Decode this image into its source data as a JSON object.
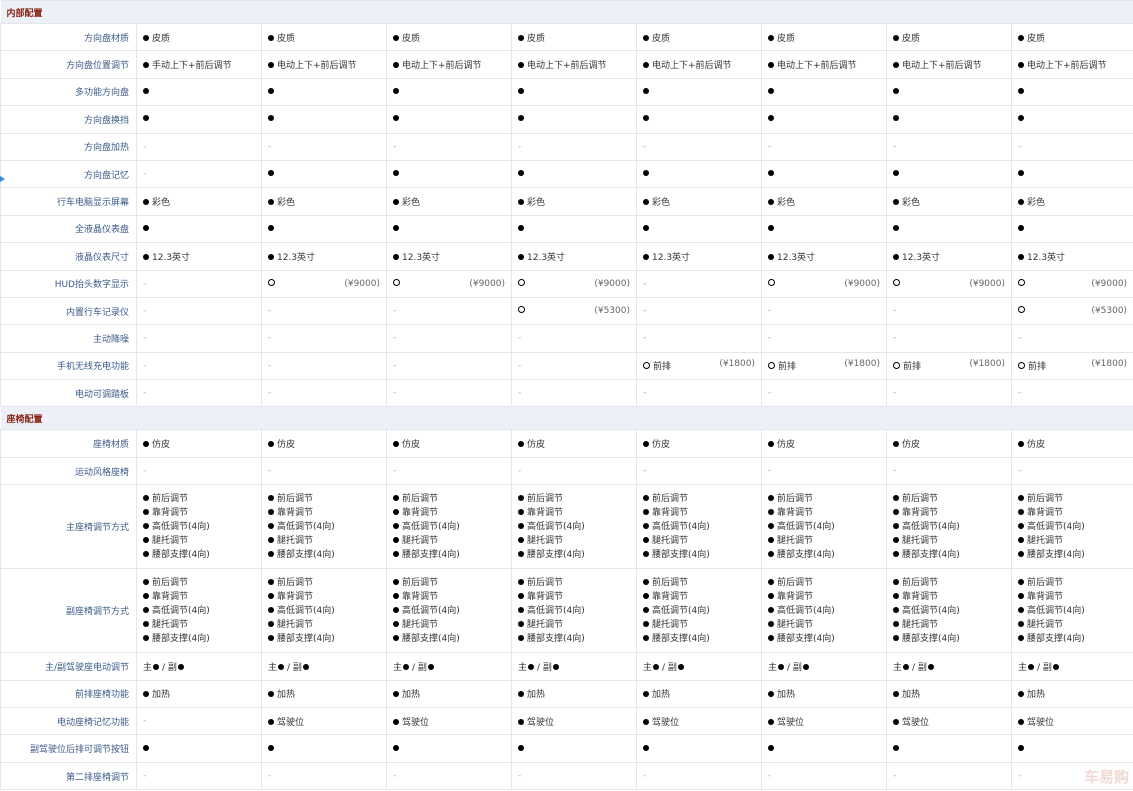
{
  "watermark": "车易购",
  "columns": 8,
  "sections": [
    {
      "title": "内部配置",
      "rows": [
        {
          "label": "方向盘材质",
          "cells": [
            {
              "dot": "filled",
              "text": "皮质"
            },
            {
              "dot": "filled",
              "text": "皮质"
            },
            {
              "dot": "filled",
              "text": "皮质"
            },
            {
              "dot": "filled",
              "text": "皮质"
            },
            {
              "dot": "filled",
              "text": "皮质"
            },
            {
              "dot": "filled",
              "text": "皮质"
            },
            {
              "dot": "filled",
              "text": "皮质"
            },
            {
              "dot": "filled",
              "text": "皮质"
            }
          ]
        },
        {
          "label": "方向盘位置调节",
          "cells": [
            {
              "dot": "filled",
              "text": "手动上下+前后调节"
            },
            {
              "dot": "filled",
              "text": "电动上下+前后调节"
            },
            {
              "dot": "filled",
              "text": "电动上下+前后调节"
            },
            {
              "dot": "filled",
              "text": "电动上下+前后调节"
            },
            {
              "dot": "filled",
              "text": "电动上下+前后调节"
            },
            {
              "dot": "filled",
              "text": "电动上下+前后调节"
            },
            {
              "dot": "filled",
              "text": "电动上下+前后调节"
            },
            {
              "dot": "filled",
              "text": "电动上下+前后调节"
            }
          ]
        },
        {
          "label": "多功能方向盘",
          "cells": [
            {
              "dot": "filled"
            },
            {
              "dot": "filled"
            },
            {
              "dot": "filled"
            },
            {
              "dot": "filled"
            },
            {
              "dot": "filled"
            },
            {
              "dot": "filled"
            },
            {
              "dot": "filled"
            },
            {
              "dot": "filled"
            }
          ]
        },
        {
          "label": "方向盘换挡",
          "cells": [
            {
              "dot": "filled"
            },
            {
              "dot": "filled"
            },
            {
              "dot": "filled"
            },
            {
              "dot": "filled"
            },
            {
              "dot": "filled"
            },
            {
              "dot": "filled"
            },
            {
              "dot": "filled"
            },
            {
              "dot": "filled"
            }
          ]
        },
        {
          "label": "方向盘加热",
          "cells": [
            {
              "text": "-"
            },
            {
              "text": "-"
            },
            {
              "text": "-"
            },
            {
              "text": "-"
            },
            {
              "text": "-"
            },
            {
              "text": "-"
            },
            {
              "text": "-"
            },
            {
              "text": "-"
            }
          ]
        },
        {
          "label": "方向盘记忆",
          "cells": [
            {
              "text": "-"
            },
            {
              "dot": "filled"
            },
            {
              "dot": "filled"
            },
            {
              "dot": "filled"
            },
            {
              "dot": "filled"
            },
            {
              "dot": "filled"
            },
            {
              "dot": "filled"
            },
            {
              "dot": "filled"
            }
          ]
        },
        {
          "label": "行车电脑显示屏幕",
          "cells": [
            {
              "dot": "filled",
              "text": "彩色"
            },
            {
              "dot": "filled",
              "text": "彩色"
            },
            {
              "dot": "filled",
              "text": "彩色"
            },
            {
              "dot": "filled",
              "text": "彩色"
            },
            {
              "dot": "filled",
              "text": "彩色"
            },
            {
              "dot": "filled",
              "text": "彩色"
            },
            {
              "dot": "filled",
              "text": "彩色"
            },
            {
              "dot": "filled",
              "text": "彩色"
            }
          ]
        },
        {
          "label": "全液晶仪表盘",
          "cells": [
            {
              "dot": "filled"
            },
            {
              "dot": "filled"
            },
            {
              "dot": "filled"
            },
            {
              "dot": "filled"
            },
            {
              "dot": "filled"
            },
            {
              "dot": "filled"
            },
            {
              "dot": "filled"
            },
            {
              "dot": "filled"
            }
          ]
        },
        {
          "label": "液晶仪表尺寸",
          "cells": [
            {
              "dot": "filled",
              "text": "12.3英寸"
            },
            {
              "dot": "filled",
              "text": "12.3英寸"
            },
            {
              "dot": "filled",
              "text": "12.3英寸"
            },
            {
              "dot": "filled",
              "text": "12.3英寸"
            },
            {
              "dot": "filled",
              "text": "12.3英寸"
            },
            {
              "dot": "filled",
              "text": "12.3英寸"
            },
            {
              "dot": "filled",
              "text": "12.3英寸"
            },
            {
              "dot": "filled",
              "text": "12.3英寸"
            }
          ]
        },
        {
          "label": "HUD抬头数字显示",
          "cells": [
            {
              "text": "-"
            },
            {
              "dot": "hollow",
              "price": "(¥9000)"
            },
            {
              "dot": "hollow",
              "price": "(¥9000)"
            },
            {
              "dot": "hollow",
              "price": "(¥9000)"
            },
            {
              "text": "-"
            },
            {
              "dot": "hollow",
              "price": "(¥9000)"
            },
            {
              "dot": "hollow",
              "price": "(¥9000)"
            },
            {
              "dot": "hollow",
              "price": "(¥9000)"
            }
          ]
        },
        {
          "label": "内置行车记录仪",
          "cells": [
            {
              "text": "-"
            },
            {
              "text": "-"
            },
            {
              "text": "-"
            },
            {
              "dot": "hollow",
              "price": "(¥5300)"
            },
            {
              "text": "-"
            },
            {
              "text": "-"
            },
            {
              "text": "-"
            },
            {
              "dot": "hollow",
              "price": "(¥5300)"
            }
          ]
        },
        {
          "label": "主动降噪",
          "cells": [
            {
              "text": "-"
            },
            {
              "text": "-"
            },
            {
              "text": "-"
            },
            {
              "text": "-"
            },
            {
              "text": "-"
            },
            {
              "text": "-"
            },
            {
              "text": "-"
            },
            {
              "text": "-"
            }
          ]
        },
        {
          "label": "手机无线充电功能",
          "cells": [
            {
              "text": "-"
            },
            {
              "text": "-"
            },
            {
              "text": "-"
            },
            {
              "text": "-"
            },
            {
              "dot": "hollow",
              "text": "前排",
              "price": "(¥1800)"
            },
            {
              "dot": "hollow",
              "text": "前排",
              "price": "(¥1800)"
            },
            {
              "dot": "hollow",
              "text": "前排",
              "price": "(¥1800)"
            },
            {
              "dot": "hollow",
              "text": "前排",
              "price": "(¥1800)"
            }
          ]
        },
        {
          "label": "电动可调踏板",
          "cells": [
            {
              "text": "-"
            },
            {
              "text": "-"
            },
            {
              "text": "-"
            },
            {
              "text": "-"
            },
            {
              "text": "-"
            },
            {
              "text": "-"
            },
            {
              "text": "-"
            },
            {
              "text": "-"
            }
          ]
        }
      ]
    },
    {
      "title": "座椅配置",
      "rows": [
        {
          "label": "座椅材质",
          "cells": [
            {
              "dot": "filled",
              "text": "仿皮"
            },
            {
              "dot": "filled",
              "text": "仿皮"
            },
            {
              "dot": "filled",
              "text": "仿皮"
            },
            {
              "dot": "filled",
              "text": "仿皮"
            },
            {
              "dot": "filled",
              "text": "仿皮"
            },
            {
              "dot": "filled",
              "text": "仿皮"
            },
            {
              "dot": "filled",
              "text": "仿皮"
            },
            {
              "dot": "filled",
              "text": "仿皮"
            }
          ]
        },
        {
          "label": "运动风格座椅",
          "cells": [
            {
              "text": "-"
            },
            {
              "text": "-"
            },
            {
              "text": "-"
            },
            {
              "text": "-"
            },
            {
              "text": "-"
            },
            {
              "text": "-"
            },
            {
              "text": "-"
            },
            {
              "text": "-"
            }
          ]
        },
        {
          "label": "主座椅调节方式",
          "multi": true,
          "cells": [
            [
              "前后调节",
              "靠背调节",
              "高低调节(4向)",
              "腿托调节",
              "腰部支撑(4向)"
            ],
            [
              "前后调节",
              "靠背调节",
              "高低调节(4向)",
              "腿托调节",
              "腰部支撑(4向)"
            ],
            [
              "前后调节",
              "靠背调节",
              "高低调节(4向)",
              "腿托调节",
              "腰部支撑(4向)"
            ],
            [
              "前后调节",
              "靠背调节",
              "高低调节(4向)",
              "腿托调节",
              "腰部支撑(4向)"
            ],
            [
              "前后调节",
              "靠背调节",
              "高低调节(4向)",
              "腿托调节",
              "腰部支撑(4向)"
            ],
            [
              "前后调节",
              "靠背调节",
              "高低调节(4向)",
              "腿托调节",
              "腰部支撑(4向)"
            ],
            [
              "前后调节",
              "靠背调节",
              "高低调节(4向)",
              "腿托调节",
              "腰部支撑(4向)"
            ],
            [
              "前后调节",
              "靠背调节",
              "高低调节(4向)",
              "腿托调节",
              "腰部支撑(4向)"
            ]
          ]
        },
        {
          "label": "副座椅调节方式",
          "multi": true,
          "cells": [
            [
              "前后调节",
              "靠背调节",
              "高低调节(4向)",
              "腿托调节",
              "腰部支撑(4向)"
            ],
            [
              "前后调节",
              "靠背调节",
              "高低调节(4向)",
              "腿托调节",
              "腰部支撑(4向)"
            ],
            [
              "前后调节",
              "靠背调节",
              "高低调节(4向)",
              "腿托调节",
              "腰部支撑(4向)"
            ],
            [
              "前后调节",
              "靠背调节",
              "高低调节(4向)",
              "腿托调节",
              "腰部支撑(4向)"
            ],
            [
              "前后调节",
              "靠背调节",
              "高低调节(4向)",
              "腿托调节",
              "腰部支撑(4向)"
            ],
            [
              "前后调节",
              "靠背调节",
              "高低调节(4向)",
              "腿托调节",
              "腰部支撑(4向)"
            ],
            [
              "前后调节",
              "靠背调节",
              "高低调节(4向)",
              "腿托调节",
              "腰部支撑(4向)"
            ],
            [
              "前后调节",
              "靠背调节",
              "高低调节(4向)",
              "腿托调节",
              "腰部支撑(4向)"
            ]
          ]
        },
        {
          "label": "主/副驾驶座电动调节",
          "dual": true,
          "cells": [
            {
              "a": "主",
              "b": "/ 副"
            },
            {
              "a": "主",
              "b": "/ 副"
            },
            {
              "a": "主",
              "b": "/ 副"
            },
            {
              "a": "主",
              "b": "/ 副"
            },
            {
              "a": "主",
              "b": "/ 副"
            },
            {
              "a": "主",
              "b": "/ 副"
            },
            {
              "a": "主",
              "b": "/ 副"
            },
            {
              "a": "主",
              "b": "/ 副"
            }
          ]
        },
        {
          "label": "前排座椅功能",
          "cells": [
            {
              "dot": "filled",
              "text": "加热"
            },
            {
              "dot": "filled",
              "text": "加热"
            },
            {
              "dot": "filled",
              "text": "加热"
            },
            {
              "dot": "filled",
              "text": "加热"
            },
            {
              "dot": "filled",
              "text": "加热"
            },
            {
              "dot": "filled",
              "text": "加热"
            },
            {
              "dot": "filled",
              "text": "加热"
            },
            {
              "dot": "filled",
              "text": "加热"
            }
          ]
        },
        {
          "label": "电动座椅记忆功能",
          "cells": [
            {
              "text": "-"
            },
            {
              "dot": "filled",
              "text": "驾驶位"
            },
            {
              "dot": "filled",
              "text": "驾驶位"
            },
            {
              "dot": "filled",
              "text": "驾驶位"
            },
            {
              "dot": "filled",
              "text": "驾驶位"
            },
            {
              "dot": "filled",
              "text": "驾驶位"
            },
            {
              "dot": "filled",
              "text": "驾驶位"
            },
            {
              "dot": "filled",
              "text": "驾驶位"
            }
          ]
        },
        {
          "label": "副驾驶位后排可调节按钮",
          "cells": [
            {
              "dot": "filled"
            },
            {
              "dot": "filled"
            },
            {
              "dot": "filled"
            },
            {
              "dot": "filled"
            },
            {
              "dot": "filled"
            },
            {
              "dot": "filled"
            },
            {
              "dot": "filled"
            },
            {
              "dot": "filled"
            }
          ]
        },
        {
          "label": "第二排座椅调节",
          "cells": [
            {
              "text": "-"
            },
            {
              "text": "-"
            },
            {
              "text": "-"
            },
            {
              "text": "-"
            },
            {
              "text": "-"
            },
            {
              "text": "-"
            },
            {
              "text": "-"
            },
            {
              "text": "-"
            }
          ]
        }
      ]
    }
  ]
}
